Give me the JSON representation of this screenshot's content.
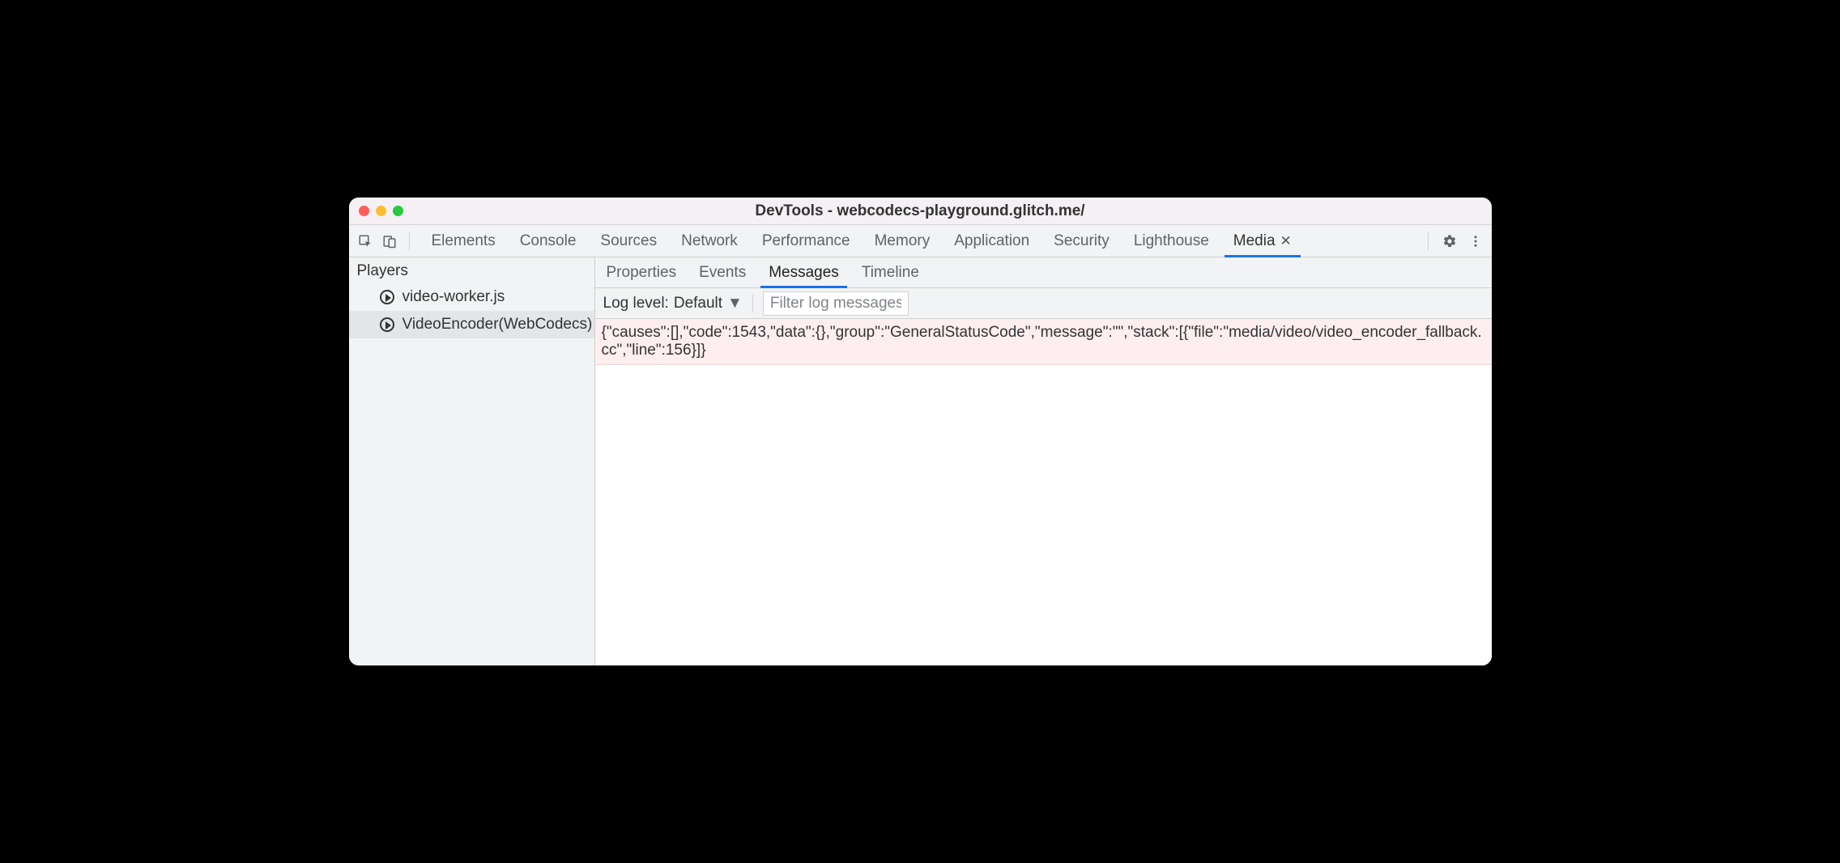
{
  "window": {
    "title": "DevTools - webcodecs-playground.glitch.me/"
  },
  "toolbar": {
    "tabs": [
      {
        "label": "Elements",
        "active": false,
        "closable": false
      },
      {
        "label": "Console",
        "active": false,
        "closable": false
      },
      {
        "label": "Sources",
        "active": false,
        "closable": false
      },
      {
        "label": "Network",
        "active": false,
        "closable": false
      },
      {
        "label": "Performance",
        "active": false,
        "closable": false
      },
      {
        "label": "Memory",
        "active": false,
        "closable": false
      },
      {
        "label": "Application",
        "active": false,
        "closable": false
      },
      {
        "label": "Security",
        "active": false,
        "closable": false
      },
      {
        "label": "Lighthouse",
        "active": false,
        "closable": false
      },
      {
        "label": "Media",
        "active": true,
        "closable": true
      }
    ]
  },
  "sidebar": {
    "heading": "Players",
    "players": [
      {
        "label": "video-worker.js",
        "selected": false
      },
      {
        "label": "VideoEncoder(WebCodecs)",
        "selected": true
      }
    ]
  },
  "subtabs": [
    {
      "label": "Properties",
      "active": false
    },
    {
      "label": "Events",
      "active": false
    },
    {
      "label": "Messages",
      "active": true
    },
    {
      "label": "Timeline",
      "active": false
    }
  ],
  "filterbar": {
    "log_level_label": "Log level:",
    "log_level_value": "Default",
    "filter_placeholder": "Filter log messages"
  },
  "log": {
    "rows": [
      {
        "level": "error",
        "text": "{\"causes\":[],\"code\":1543,\"data\":{},\"group\":\"GeneralStatusCode\",\"message\":\"\",\"stack\":[{\"file\":\"media/video/video_encoder_fallback.cc\",\"line\":156}]}"
      }
    ]
  }
}
